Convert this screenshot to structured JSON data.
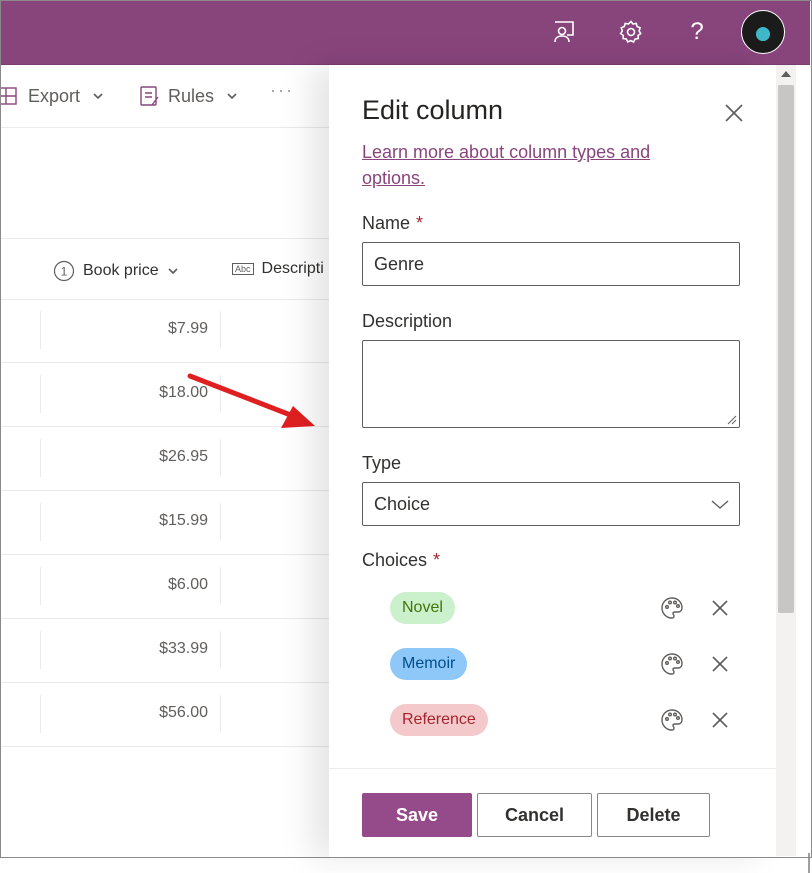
{
  "topbar": {
    "icons": [
      "feedback-icon",
      "settings-icon",
      "help-icon"
    ],
    "help_glyph": "?",
    "accent": "#88457c"
  },
  "commandbar": {
    "export_label": "Export",
    "rules_label": "Rules",
    "more_glyph": "···"
  },
  "list": {
    "columns": [
      {
        "label": "Book price",
        "type_glyph": "1"
      },
      {
        "label": "Descripti",
        "type_glyph": "Abc"
      }
    ],
    "prices": [
      "$7.99",
      "$18.00",
      "$26.95",
      "$15.99",
      "$6.00",
      "$33.99",
      "$56.00"
    ]
  },
  "panel": {
    "title": "Edit column",
    "learn_more": "Learn more about column types and options.",
    "name_label": "Name",
    "required_mark": "*",
    "name_value": "Genre",
    "description_label": "Description",
    "description_value": "",
    "type_label": "Type",
    "type_value": "Choice",
    "choices_label": "Choices",
    "choices": [
      {
        "label": "Novel",
        "bg": "#caf0cc",
        "fg": "#437406"
      },
      {
        "label": "Memoir",
        "bg": "#8dc8f8",
        "fg": "#004e8c"
      },
      {
        "label": "Reference",
        "bg": "#f4c9cc",
        "fg": "#a4262c"
      }
    ],
    "buttons": {
      "save": "Save",
      "cancel": "Cancel",
      "delete": "Delete"
    }
  }
}
